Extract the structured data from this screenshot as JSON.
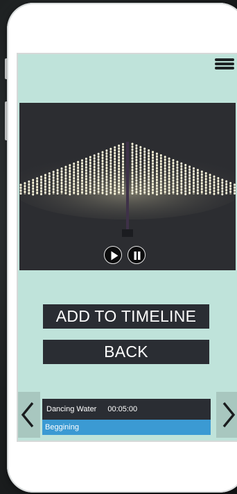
{
  "icons": {
    "menu": "hamburger-menu-icon",
    "play": "play-icon",
    "pause": "pause-icon",
    "prev": "chevron-left-icon",
    "next": "chevron-right-icon"
  },
  "colors": {
    "screen_bg": "#bfe3da",
    "button_bg": "#2a2d33",
    "button_text": "#ffffff",
    "highlight": "#3b9ad3",
    "nav_arrow_bg": "#a8c7bf",
    "player_bg": "#2c2d31",
    "light_glow": "#fffbe0"
  },
  "actions": {
    "add_to_timeline": "ADD TO TIMELINE",
    "back": "BACK"
  },
  "timeline": {
    "entry": {
      "name": "Dancing Water",
      "duration": "00:05:00"
    },
    "selected_label": "Beggining"
  }
}
